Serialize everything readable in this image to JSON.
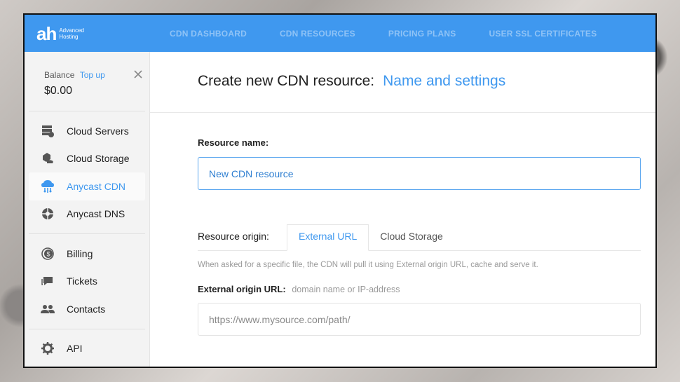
{
  "brand": {
    "mark": "ah",
    "line1": "Advanced",
    "line2": "Hosting"
  },
  "nav": [
    {
      "label": "CDN DASHBOARD"
    },
    {
      "label": "CDN RESOURCES"
    },
    {
      "label": "PRICING PLANS"
    },
    {
      "label": "USER SSL CERTIFICATES"
    }
  ],
  "sidebar": {
    "balance_label": "Balance",
    "topup_label": "Top up",
    "balance_amount": "$0.00",
    "group1": [
      {
        "label": "Cloud Servers",
        "icon": "server-icon"
      },
      {
        "label": "Cloud Storage",
        "icon": "storage-icon"
      },
      {
        "label": "Anycast CDN",
        "icon": "cdn-cloud-icon",
        "active": true
      },
      {
        "label": "Anycast DNS",
        "icon": "dns-icon"
      }
    ],
    "group2": [
      {
        "label": "Billing",
        "icon": "billing-icon"
      },
      {
        "label": "Tickets",
        "icon": "tickets-icon"
      },
      {
        "label": "Contacts",
        "icon": "contacts-icon"
      }
    ],
    "group3": [
      {
        "label": "API",
        "icon": "gear-icon"
      }
    ]
  },
  "page": {
    "title": "Create new CDN resource:",
    "step": "Name and settings"
  },
  "form": {
    "name_label": "Resource name:",
    "name_value": "New CDN resource",
    "origin_label": "Resource origin:",
    "tabs": [
      {
        "label": "External URL",
        "active": true
      },
      {
        "label": "Cloud Storage",
        "active": false
      }
    ],
    "hint": "When asked for a specific file, the CDN will pull it using External origin URL, cache and serve it.",
    "url_label": "External origin URL:",
    "url_hint": "domain name or IP-address",
    "url_placeholder": "https://www.mysource.com/path/"
  },
  "colors": {
    "accent": "#3f98ef",
    "topbar": "#3f98ef"
  }
}
